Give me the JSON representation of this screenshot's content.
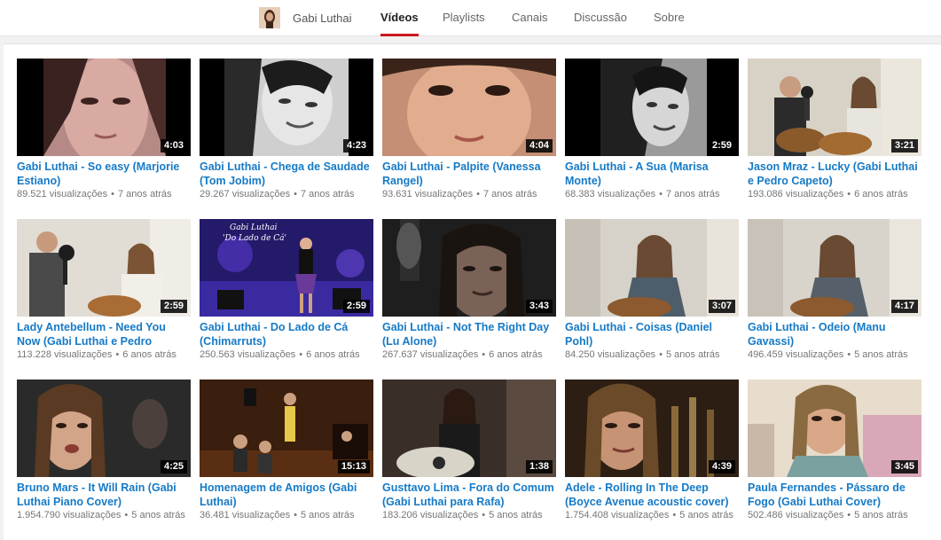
{
  "header": {
    "channel_name": "Gabi Luthai",
    "tabs": [
      {
        "label": "Vídeos",
        "active": true
      },
      {
        "label": "Playlists",
        "active": false
      },
      {
        "label": "Canais",
        "active": false
      },
      {
        "label": "Discussão",
        "active": false
      },
      {
        "label": "Sobre",
        "active": false
      }
    ]
  },
  "colors": {
    "accent": "#cc181e",
    "link": "#167ac6",
    "meta": "#767676"
  },
  "videos": [
    {
      "title": "Gabi Luthai - So easy (Marjorie Estiano)",
      "views": "89.521 visualizações",
      "age": "7 anos atrás",
      "duration": "4:03"
    },
    {
      "title": "Gabi Luthai - Chega de Saudade (Tom Jobim)",
      "views": "29.267 visualizações",
      "age": "7 anos atrás",
      "duration": "4:23"
    },
    {
      "title": "Gabi Luthai - Palpite (Vanessa Rangel)",
      "views": "93.631 visualizações",
      "age": "7 anos atrás",
      "duration": "4:04"
    },
    {
      "title": "Gabi Luthai - A Sua (Marisa Monte)",
      "views": "68.383 visualizações",
      "age": "7 anos atrás",
      "duration": "2:59"
    },
    {
      "title": "Jason Mraz - Lucky (Gabi Luthai e Pedro Capeto)",
      "views": "193.086 visualizações",
      "age": "6 anos atrás",
      "duration": "3:21"
    },
    {
      "title": "Lady Antebellum - Need You Now (Gabi Luthai e Pedro Capeto)",
      "views": "113.228 visualizações",
      "age": "6 anos atrás",
      "duration": "2:59"
    },
    {
      "title": "Gabi Luthai - Do Lado de Cá (Chimarruts)",
      "views": "250.563 visualizações",
      "age": "6 anos atrás",
      "duration": "2:59"
    },
    {
      "title": "Gabi Luthai - Not The Right Day (Lu Alone)",
      "views": "267.637 visualizações",
      "age": "6 anos atrás",
      "duration": "3:43"
    },
    {
      "title": "Gabi Luthai - Coisas (Daniel Pohl)",
      "views": "84.250 visualizações",
      "age": "5 anos atrás",
      "duration": "3:07"
    },
    {
      "title": "Gabi Luthai - Odeio (Manu Gavassi)",
      "views": "496.459 visualizações",
      "age": "5 anos atrás",
      "duration": "4:17"
    },
    {
      "title": "Bruno Mars - It Will Rain (Gabi Luthai Piano Cover)",
      "views": "1.954.790 visualizações",
      "age": "5 anos atrás",
      "duration": "4:25"
    },
    {
      "title": "Homenagem de Amigos (Gabi Luthai)",
      "views": "36.481 visualizações",
      "age": "5 anos atrás",
      "duration": "15:13"
    },
    {
      "title": "Gusttavo Lima - Fora do Comum (Gabi Luthai para Rafa)",
      "views": "183.206 visualizações",
      "age": "5 anos atrás",
      "duration": "1:38"
    },
    {
      "title": "Adele - Rolling In The Deep (Boyce Avenue acoustic cover) ...",
      "views": "1.754.408 visualizações",
      "age": "5 anos atrás",
      "duration": "4:39"
    },
    {
      "title": "Paula Fernandes - Pássaro de Fogo (Gabi Luthai Cover)",
      "views": "502.486 visualizações",
      "age": "5 anos atrás",
      "duration": "3:45"
    }
  ],
  "thumbnail_overlay_text": {
    "do_lado_de_ca": [
      "Gabi Luthai",
      "'Do Lado de Cá'"
    ]
  }
}
